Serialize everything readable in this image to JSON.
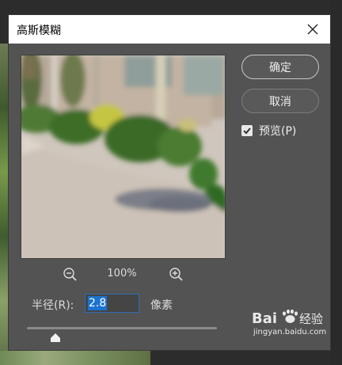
{
  "dialog": {
    "title": "高斯模糊"
  },
  "buttons": {
    "ok_label": "确定",
    "cancel_label": "取消"
  },
  "preview_option": {
    "label": "预览(P)",
    "checked": true
  },
  "zoom": {
    "level": "100%"
  },
  "radius": {
    "label": "半径(R):",
    "value": "2.8",
    "unit": "像素"
  },
  "watermark": {
    "brand": "Baidu经验",
    "url": "jingyan.baidu.com"
  },
  "icons": {
    "close": "close-icon",
    "zoom_out": "zoom-out-icon",
    "zoom_in": "zoom-in-icon",
    "checkbox": "checkmark-icon",
    "slider": "slider-thumb-icon"
  },
  "colors": {
    "dialog_bg": "#535353",
    "titlebar_bg": "#ffffff",
    "selection": "#1a73d1",
    "input_border": "#2f6cb3"
  }
}
